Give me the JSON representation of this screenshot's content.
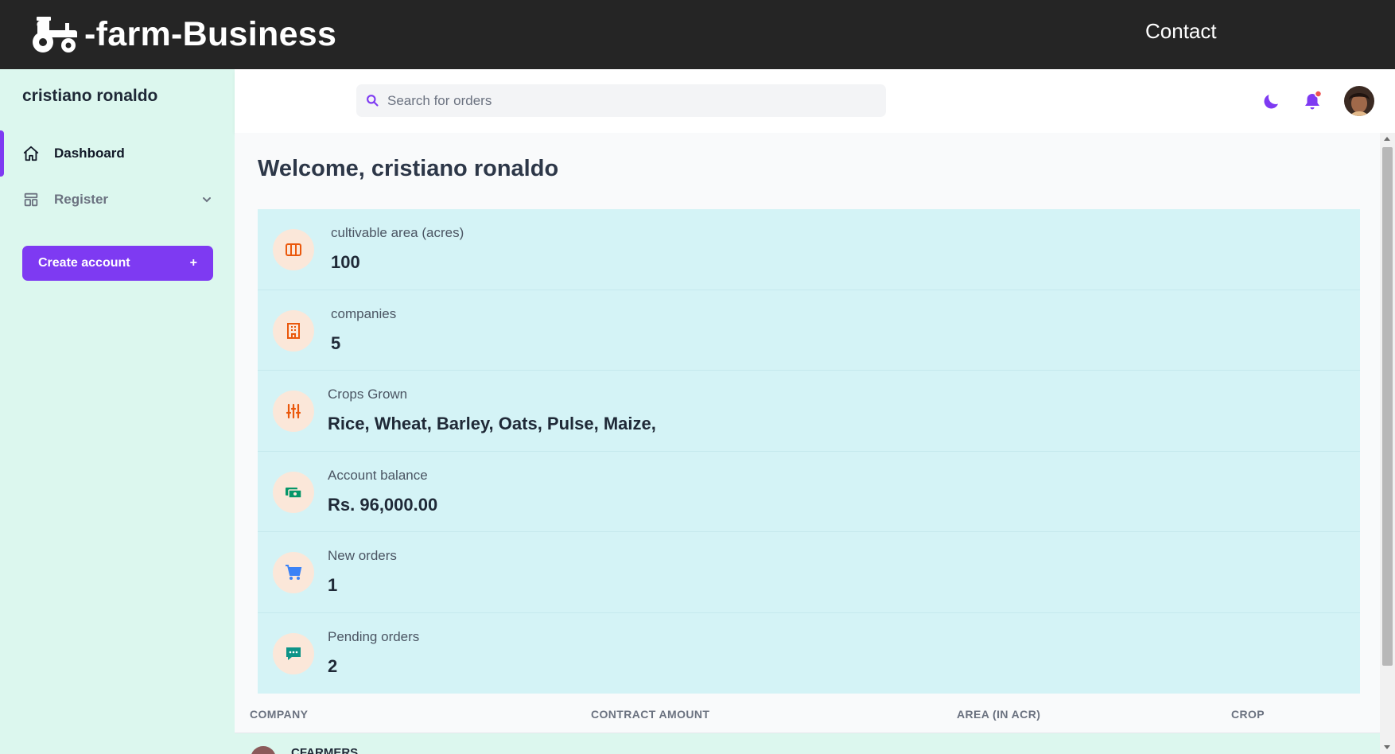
{
  "brand": {
    "name": "-farm-Business",
    "logo_icon": "tractor-icon"
  },
  "topnav": {
    "contact_label": "Contact"
  },
  "sidebar": {
    "user_name": "cristiano ronaldo",
    "items": [
      {
        "label": "Dashboard",
        "icon": "home-icon",
        "active": true
      },
      {
        "label": "Register",
        "icon": "template-icon",
        "has_submenu": true
      }
    ],
    "create_button": {
      "label": "Create account",
      "icon": "+"
    }
  },
  "header": {
    "search_placeholder": "Search for orders",
    "icons": [
      "moon-icon",
      "bell-icon",
      "avatar"
    ],
    "notification_dot_color": "#f05252"
  },
  "main": {
    "welcome": "Welcome, cristiano ronaldo",
    "cards": [
      {
        "label": "cultivable area (acres)",
        "value": "100",
        "icon": "columns-icon",
        "icon_color": "#ea580c"
      },
      {
        "label": "companies",
        "value": "5",
        "icon": "building-icon",
        "icon_color": "#ea580c"
      },
      {
        "label": "Crops Grown",
        "value": "Rice, Wheat, Barley, Oats, Pulse, Maize,",
        "icon": "adjustments-icon",
        "icon_color": "#ea580c"
      },
      {
        "label": "Account balance",
        "value": "Rs. 96,000.00",
        "icon": "cash-icon",
        "icon_color": "#059669"
      },
      {
        "label": "New orders",
        "value": "1",
        "icon": "cart-icon",
        "icon_color": "#3b82f6"
      },
      {
        "label": "Pending orders",
        "value": "2",
        "icon": "chat-icon",
        "icon_color": "#0d9488"
      }
    ],
    "table": {
      "columns": [
        "COMPANY",
        "CONTRACT AMOUNT",
        "AREA (IN ACR)",
        "CROP"
      ],
      "rows": [
        {
          "company": "CFARMERS"
        }
      ]
    }
  },
  "colors": {
    "accent": "#7e3af2",
    "sidebar_bg": "#dcf7ee",
    "cards_bg": "#d4f3f6",
    "topbar_bg": "#252525"
  }
}
